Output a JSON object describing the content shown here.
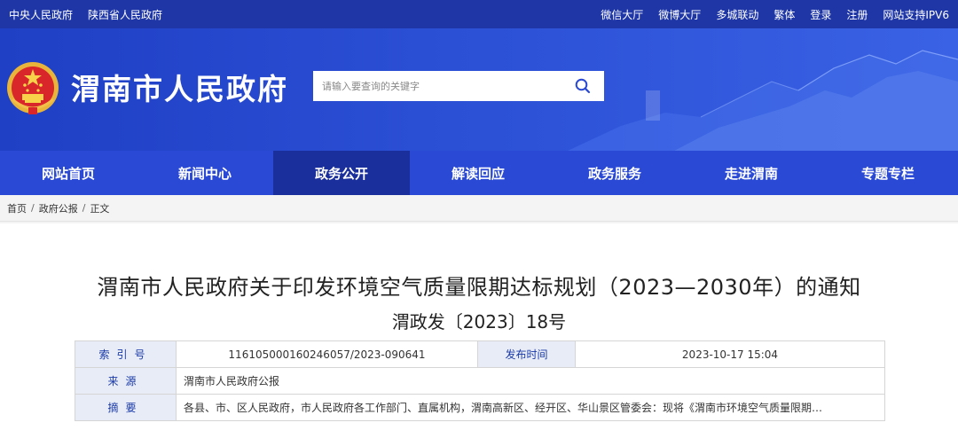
{
  "topbar": {
    "left_links": [
      "中央人民政府",
      "陕西省人民政府"
    ],
    "right_links": [
      "微信大厅",
      "微博大厅",
      "多城联动",
      "繁体",
      "登录",
      "注册",
      "网站支持IPV6"
    ]
  },
  "header": {
    "site_title": "渭南市人民政府",
    "emblem_icon": "national-emblem-icon",
    "search_placeholder": "请输入要查询的关键字",
    "search_icon": "search-icon"
  },
  "nav": {
    "items": [
      "网站首页",
      "新闻中心",
      "政务公开",
      "解读回应",
      "政务服务",
      "走进渭南",
      "专题专栏"
    ],
    "active_index": 2
  },
  "breadcrumb": [
    "首页",
    "政府公报",
    "正文"
  ],
  "document": {
    "title": "渭南市人民政府关于印发环境空气质量限期达标规划（2023—2030年）的通知",
    "doc_number": "渭政发〔2023〕18号"
  },
  "meta": {
    "index_label": "索引号",
    "index_value": "11610500016024605​7/2023-090641",
    "publish_label": "发布时间",
    "publish_value": "2023-10-17 15:04",
    "source_label": "来源",
    "source_value": "渭南市人民政府公报",
    "abstract_label": "摘要",
    "abstract_value": "各县、市、区人民政府，市人民政府各工作部门、直属机构，渭南高新区、经开区、华山景区管委会：现将《渭南市环境空气质量限期…"
  },
  "colors": {
    "topbar": "#1e36a6",
    "header": "#2d52d8",
    "nav": "#2a49d4",
    "nav_active": "#1a2f9c",
    "meta_label_bg": "#e8ecf6",
    "meta_label_text": "#1a3aa8"
  }
}
